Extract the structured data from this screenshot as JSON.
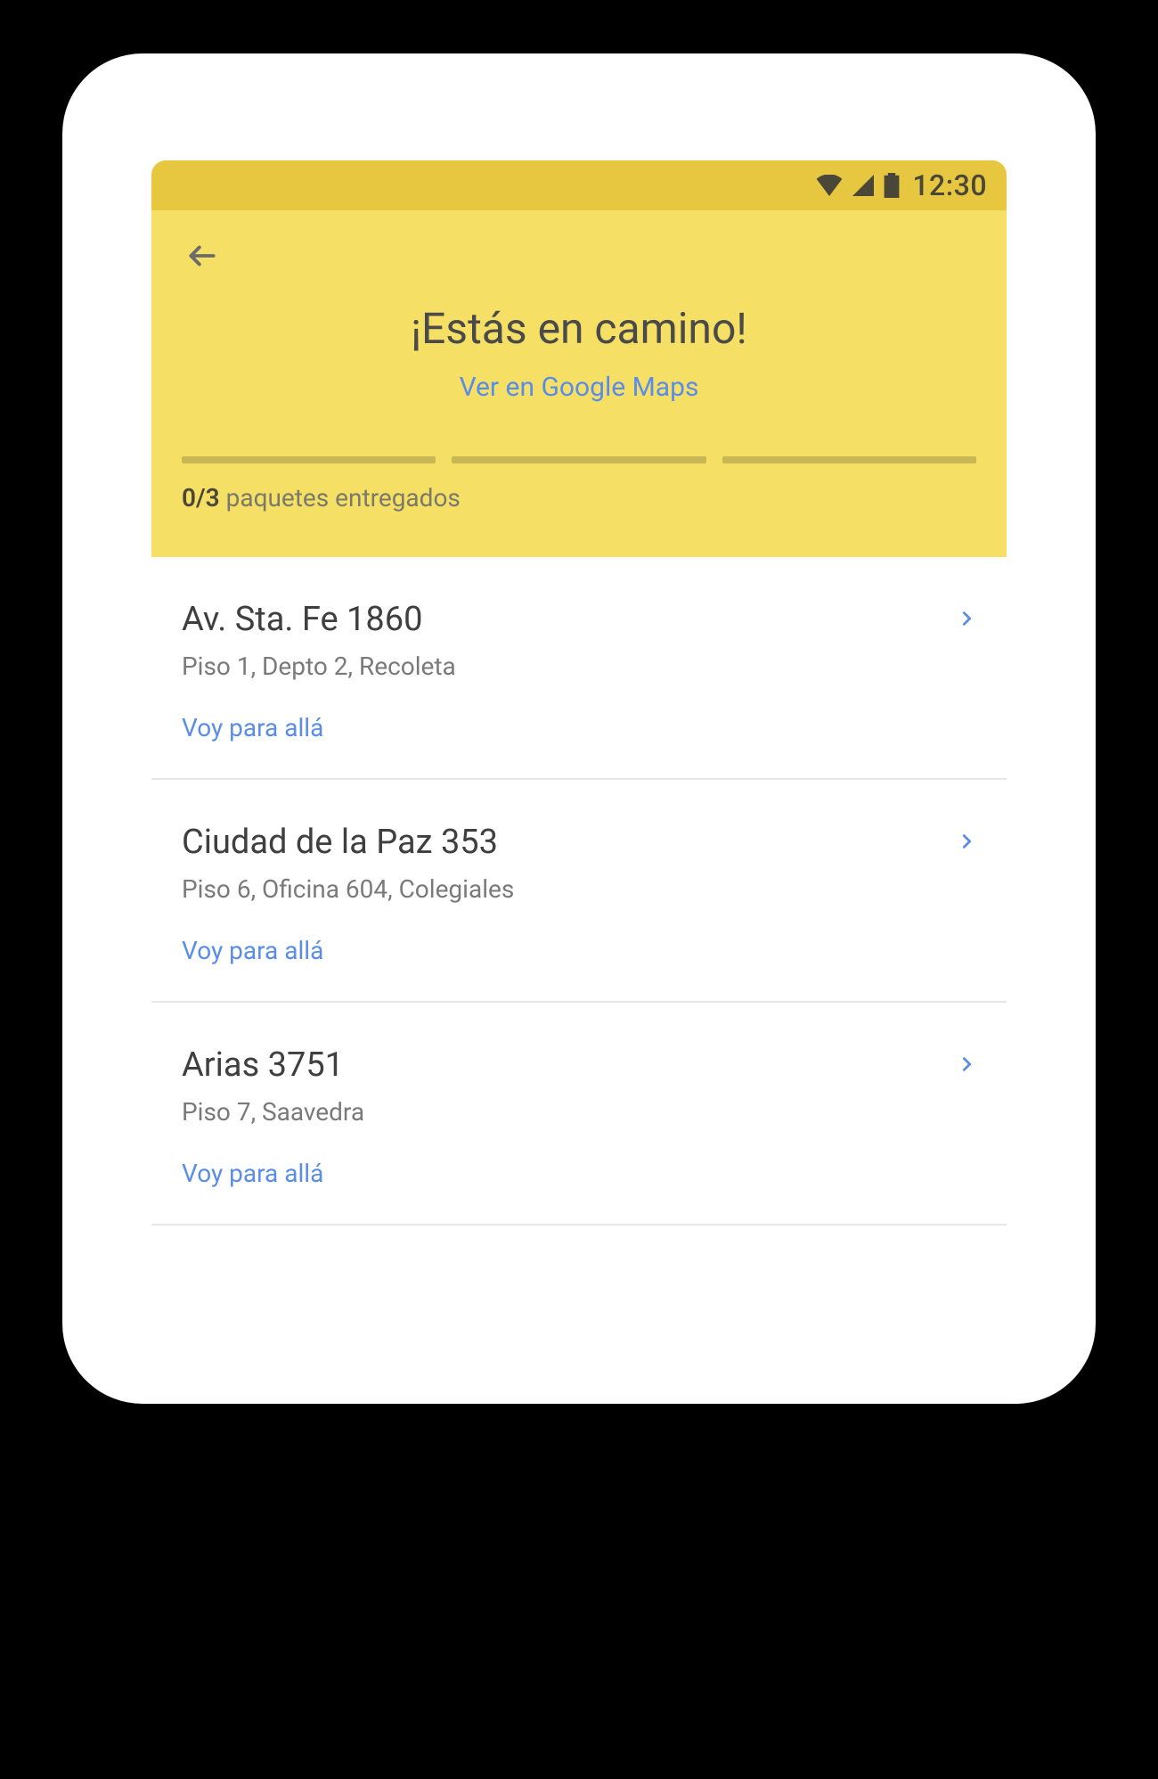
{
  "status_bar": {
    "time": "12:30"
  },
  "header": {
    "title": "¡Estás en camino!",
    "maps_link": "Ver en Google Maps",
    "delivered_count": "0/3",
    "delivered_label": "paquetes entregados"
  },
  "action_label": "Voy para allá",
  "stops": [
    {
      "address": "Av. Sta. Fe 1860",
      "detail": "Piso 1, Depto 2, Recoleta"
    },
    {
      "address": "Ciudad de la Paz 353",
      "detail": "Piso 6, Oficina 604, Colegiales"
    },
    {
      "address": "Arias 3751",
      "detail": "Piso 7, Saavedra"
    }
  ]
}
